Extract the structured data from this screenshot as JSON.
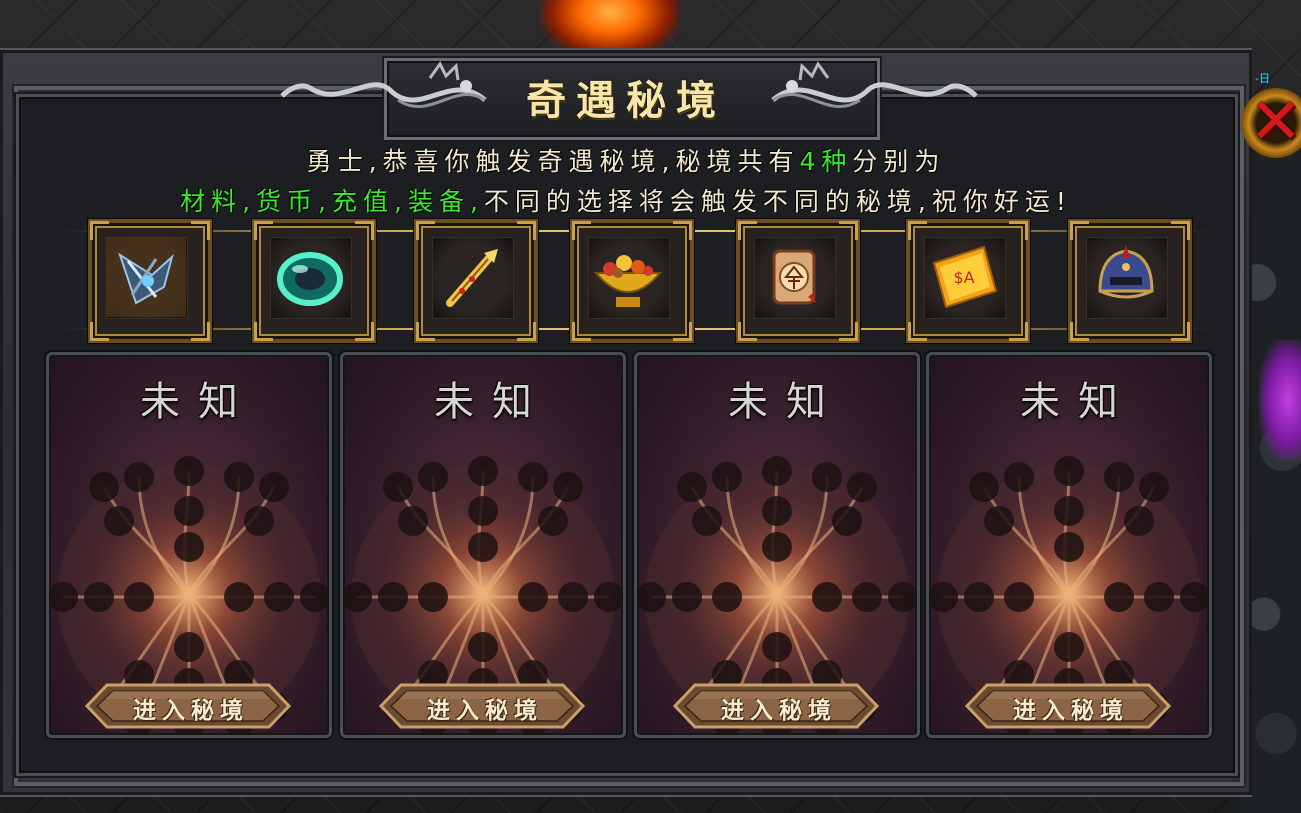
{
  "window": {
    "title": "奇遇秘境",
    "close_icon": "close-x-icon",
    "close_badge": "-日"
  },
  "intro": {
    "line1_prefix": "勇士,恭喜你触发奇遇秘境,秘境共有",
    "line1_highlight": "4种",
    "line1_suffix": "分别为",
    "line2_highlight": "材料,货币,充值,装备,",
    "line2_suffix": "不同的选择将会触发不同的秘境,祝你好运!",
    "highlight_color": "#3aea2c"
  },
  "rewards": [
    {
      "icon": "armor-shard-icon"
    },
    {
      "icon": "jade-ring-icon"
    },
    {
      "icon": "golden-sword-icon"
    },
    {
      "icon": "treasure-bowl-icon"
    },
    {
      "icon": "gold-token-card-icon"
    },
    {
      "icon": "red-envelope-ticket-icon"
    },
    {
      "icon": "warrior-helmet-icon"
    }
  ],
  "realms": [
    {
      "title": "未知",
      "button": "进入秘境"
    },
    {
      "title": "未知",
      "button": "进入秘境"
    },
    {
      "title": "未知",
      "button": "进入秘境"
    },
    {
      "title": "未知",
      "button": "进入秘境"
    }
  ],
  "colors": {
    "title_gold": "#f6e7a8",
    "frame_gold": "#c9a14a",
    "card_purple": "#3d2230"
  }
}
